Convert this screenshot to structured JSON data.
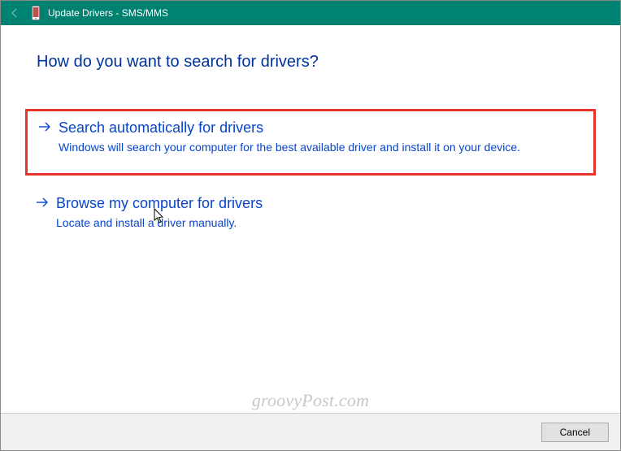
{
  "titlebar": {
    "back_icon": "back-arrow-icon",
    "device_icon": "phone-icon",
    "title": "Update Drivers - SMS/MMS"
  },
  "heading": "How do you want to search for drivers?",
  "options": [
    {
      "title": "Search automatically for drivers",
      "description": "Windows will search your computer for the best available driver and install it on your device.",
      "highlighted": true
    },
    {
      "title": "Browse my computer for drivers",
      "description": "Locate and install a driver manually.",
      "highlighted": false
    }
  ],
  "footer": {
    "cancel_label": "Cancel"
  },
  "watermark": "groovyPost.com"
}
